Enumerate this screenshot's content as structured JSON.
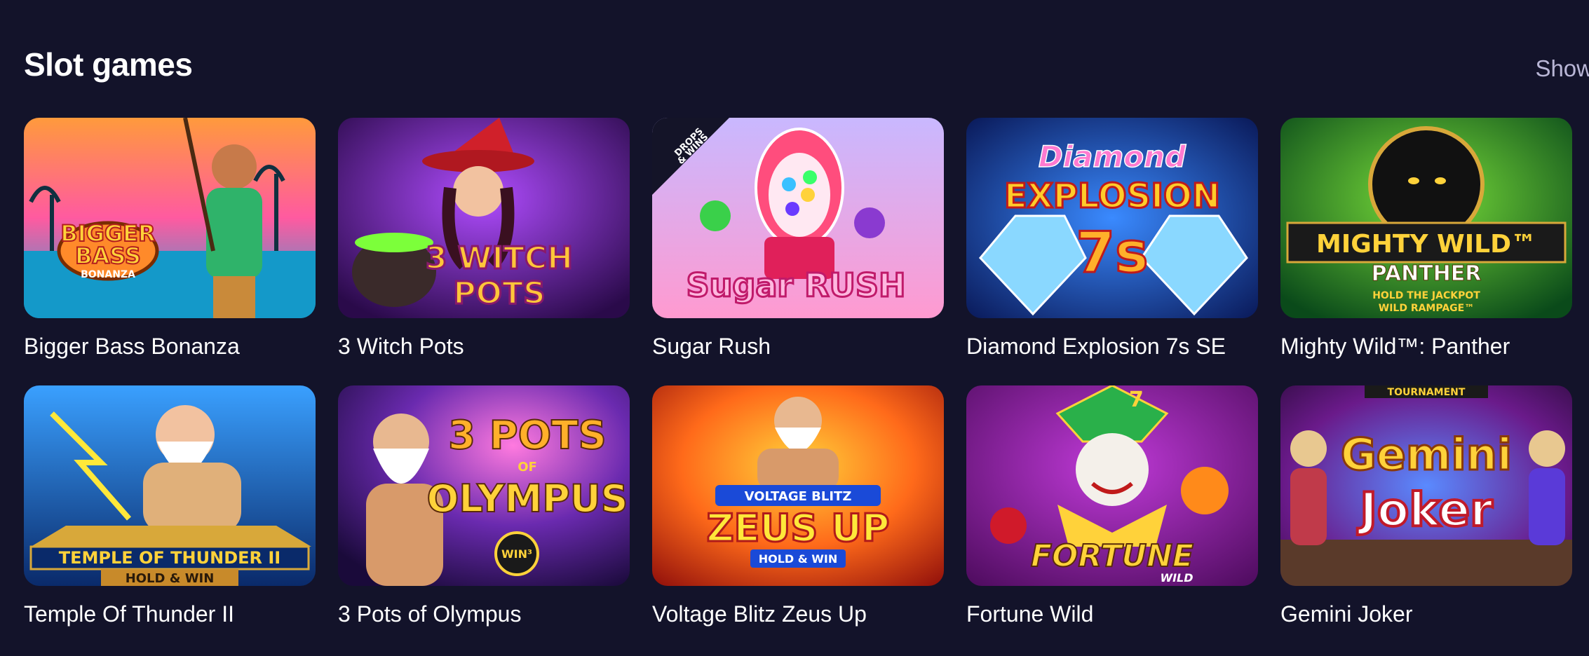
{
  "section": {
    "title": "Slot games",
    "show_label": "Show"
  },
  "games": [
    {
      "title": "Bigger Bass Bonanza",
      "logo_lines": [
        "BIGGER",
        "BASS"
      ],
      "logo_sub": "BONANZA",
      "badge": "",
      "icon": "fisherman-art"
    },
    {
      "title": "3 Witch Pots",
      "logo_lines": [
        "3 WITCH",
        "POTS"
      ],
      "logo_sub": "",
      "badge": "",
      "icon": "witch-art"
    },
    {
      "title": "Sugar Rush",
      "logo_lines": [
        "Sugar RUSH"
      ],
      "logo_sub": "",
      "badge": "DROPS & WINS",
      "icon": "gumball-machine-art"
    },
    {
      "title": "Diamond Explosion 7s SE",
      "logo_lines": [
        "Diamond",
        "EXPLOSION",
        "7s"
      ],
      "logo_sub": "",
      "badge": "",
      "icon": "diamond-art"
    },
    {
      "title": "Mighty Wild™: Panther",
      "logo_lines": [
        "MIGHTY WILD™",
        "PANTHER"
      ],
      "logo_sub": "HOLD THE JACKPOT WILD RAMPAGE™",
      "badge": "",
      "icon": "panther-art"
    },
    {
      "title": "Temple Of Thunder II",
      "logo_lines": [
        "TEMPLE OF THUNDER II"
      ],
      "logo_sub": "HOLD & WIN",
      "badge": "",
      "icon": "zeus-art"
    },
    {
      "title": "3 Pots of Olympus",
      "logo_lines": [
        "3 POTS",
        "OLYMPUS"
      ],
      "logo_sub": "WIN³",
      "badge": "",
      "icon": "olympus-god-art"
    },
    {
      "title": "Voltage Blitz Zeus Up",
      "logo_lines": [
        "VOLTAGE BLITZ",
        "ZEUS UP"
      ],
      "logo_sub": "HOLD & WIN",
      "badge": "",
      "icon": "zeus-lightning-art"
    },
    {
      "title": "Fortune Wild",
      "logo_lines": [
        "FORTUNE"
      ],
      "logo_sub": "WILD",
      "badge": "",
      "icon": "jester-art"
    },
    {
      "title": "Gemini Joker",
      "logo_lines": [
        "Gemini",
        "Joker"
      ],
      "logo_sub": "TOURNAMENT",
      "badge": "",
      "icon": "joker-art"
    }
  ],
  "colors": {
    "background": "#13132a",
    "title": "#ffffff",
    "show_link": "#b9b6d6"
  }
}
